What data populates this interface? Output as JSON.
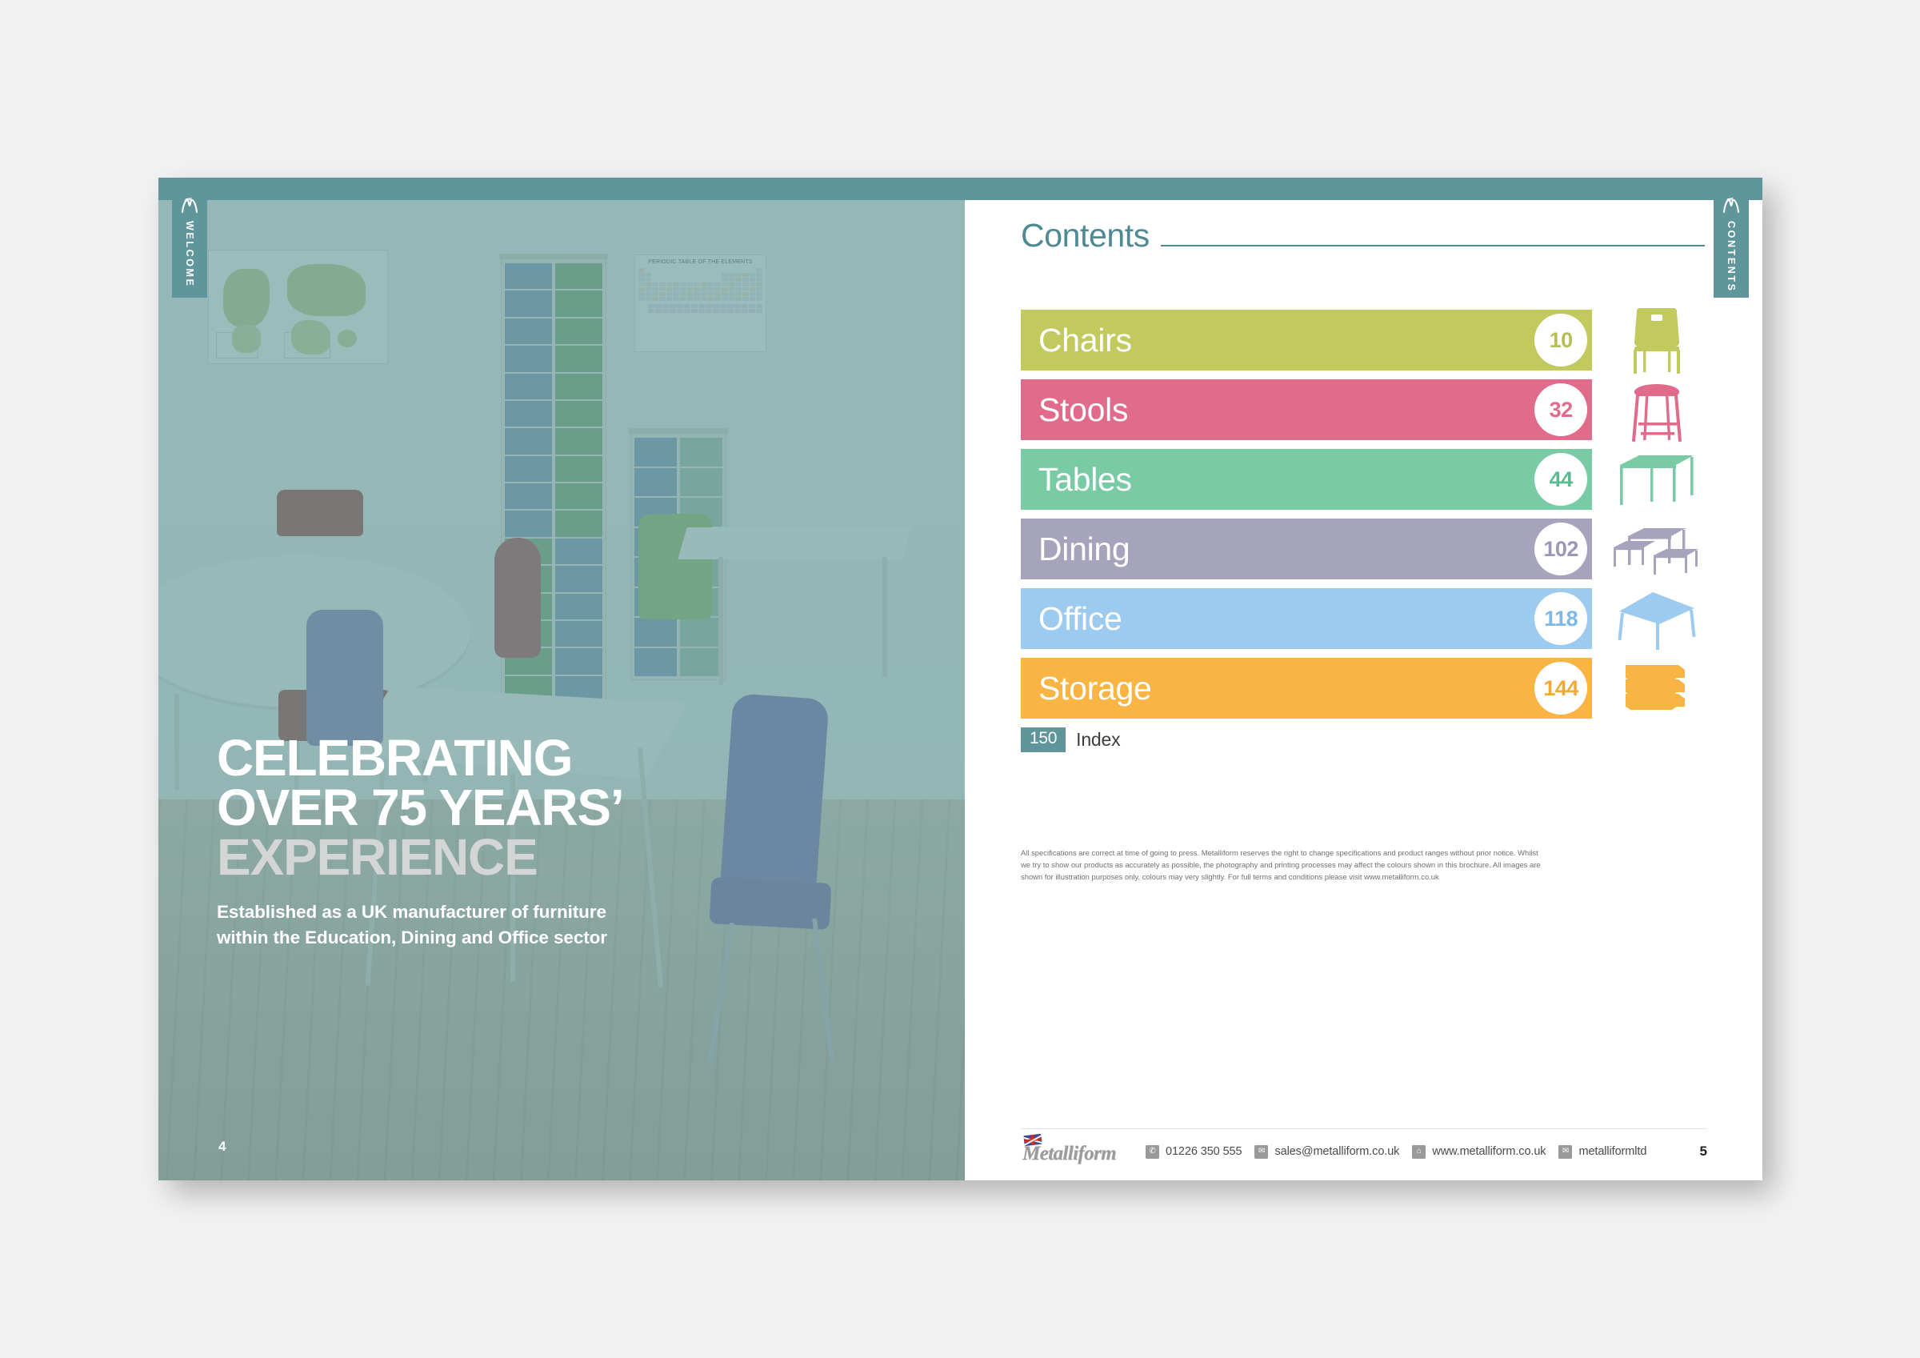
{
  "spread": {
    "left_page": {
      "tab_label": "WELCOME",
      "logo_glyph": "M",
      "page_number": "4",
      "headline": {
        "line1": "CELEBRATING",
        "line2": "OVER 75 YEARS’",
        "line3": "EXPERIENCE"
      },
      "subheading": {
        "line1": "Established as a UK manufacturer of furniture",
        "line2": "within the Education, Dining and Office sector"
      },
      "photo": {
        "poster_periodic_title": "PERIODIC TABLE OF THE ELEMENTS",
        "tint_color": "#64a0a0"
      }
    },
    "right_page": {
      "tab_label": "CONTENTS",
      "logo_glyph": "M",
      "title": "Contents",
      "page_number": "5",
      "items": [
        {
          "label": "Chairs",
          "page": "10",
          "color": "#c2ca5e",
          "badge_text_color": "#b6bf52",
          "icon": "chair-icon"
        },
        {
          "label": "Stools",
          "page": "32",
          "color": "#e06b8b",
          "badge_text_color": "#e06b8b",
          "icon": "stool-icon"
        },
        {
          "label": "Tables",
          "page": "44",
          "color": "#79cba5",
          "badge_text_color": "#5cbb8e",
          "icon": "table-icon"
        },
        {
          "label": "Dining",
          "page": "102",
          "color": "#a6a3bd",
          "badge_text_color": "#9b98b6",
          "icon": "dining-bench-icon"
        },
        {
          "label": "Office",
          "page": "118",
          "color": "#9dcaef",
          "badge_text_color": "#7fb8e6",
          "icon": "office-desk-icon"
        },
        {
          "label": "Storage",
          "page": "144",
          "color": "#f9b443",
          "badge_text_color": "#f2a838",
          "icon": "storage-trays-icon"
        }
      ],
      "index": {
        "page": "150",
        "label": "Index",
        "chip_color": "#5f969c"
      },
      "disclaimer": "All specifications are correct at time of going to press. Metalliform reserves the right to change specifications and product ranges without prior notice. Whilst we try to show our products as accurately as possible, the photography and printing processes may affect the colours shown in this brochure. All images are shown for illustration purposes only, colours may very slightly. For full terms and conditions please visit www.metalliform.co.uk",
      "footer": {
        "brand": "Metalliform",
        "phone": "01226 350 555",
        "email": "sales@metalliform.co.uk",
        "website": "www.metalliform.co.uk",
        "twitter": "metalliformltd"
      }
    }
  },
  "theme": {
    "teal": "#5f969c",
    "title_teal": "#4d8a93",
    "page_bg": "#f2f2f2"
  }
}
